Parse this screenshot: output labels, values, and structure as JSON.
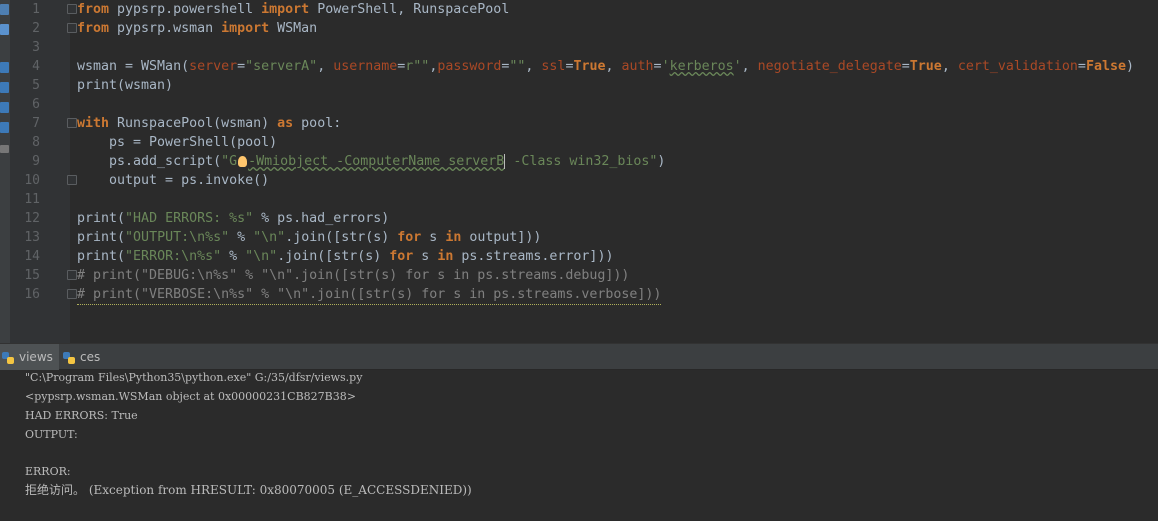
{
  "editor": {
    "line_numbers": [
      "1",
      "2",
      "3",
      "4",
      "5",
      "6",
      "7",
      "8",
      "9",
      "10",
      "11",
      "12",
      "13",
      "14",
      "15",
      "16"
    ],
    "code": {
      "l1": {
        "kw1": "from",
        "mod": " pypsrp.powershell ",
        "kw2": "import",
        "rest": " PowerShell, RunspacePool"
      },
      "l2": {
        "kw1": "from",
        "mod": " pypsrp.wsman ",
        "kw2": "import",
        "rest": " WSMan"
      },
      "l4": {
        "a": "wsman = WSMan(",
        "p1": "server",
        "eq1": "=",
        "s1": "\"serverA\"",
        "c1": ", ",
        "p2": "username",
        "eq2": "=",
        "s2": "r\"\"",
        "c2": ",",
        "p3": "password",
        "eq3": "=",
        "s3": "\"\"",
        "c3": ", ",
        "p4": "ssl",
        "eq4": "=",
        "k4": "True",
        "c4": ", ",
        "p5": "auth",
        "eq5": "=",
        "s5a": "'",
        "s5b": "kerberos",
        "s5c": "'",
        "c5": ", ",
        "p6": "negotiate_delegate",
        "eq6": "=",
        "k6": "True",
        "c6": ", ",
        "p7": "cert_validation",
        "eq7": "=",
        "k7": "False",
        "end": ")"
      },
      "l5": {
        "text": "print(wsman)"
      },
      "l7": {
        "kw1": "with",
        "mid": " RunspacePool(wsman) ",
        "kw2": "as",
        "rest": " pool:"
      },
      "l8": {
        "text": "    ps = PowerShell(pool)"
      },
      "l9": {
        "pre": "    ps.add_script(",
        "s1": "\"G",
        "s2": "-Wmiobject -ComputerName serverB",
        "s3": " -Class win32_bios\"",
        "end": ")"
      },
      "l10": {
        "text": "    output = ps.invoke()"
      },
      "l12": {
        "pre": "print(",
        "s": "\"HAD ERRORS: %s\"",
        "rest": " % ps.had_errors)"
      },
      "l13": {
        "pre": "print(",
        "s": "\"OUTPUT:\\n%s\"",
        "mid": " % ",
        "s2": "\"\\n\"",
        "rest1": ".join([str(s) ",
        "kw1": "for",
        "rest2": " s ",
        "kw2": "in",
        "rest3": " output]))"
      },
      "l14": {
        "pre": "print(",
        "s": "\"ERROR:\\n%s\"",
        "mid": " % ",
        "s2": "\"\\n\"",
        "rest1": ".join([str(s) ",
        "kw1": "for",
        "rest2": " s ",
        "kw2": "in",
        "rest3": " ps.streams.error]))"
      },
      "l15": {
        "text": "# print(\"DEBUG:\\n%s\" % \"\\n\".join([str(s) for s in ps.streams.debug]))"
      },
      "l16": {
        "text": "# print(\"VERBOSE:\\n%s\" % \"\\n\".join([str(s) for s in ps.streams.verbose]))"
      }
    }
  },
  "run_tabs": [
    {
      "label": "views"
    },
    {
      "label": "ces"
    }
  ],
  "console": {
    "lines": [
      "\"C:\\Program Files\\Python35\\python.exe\" G:/35/dfsr/views.py",
      "<pypsrp.wsman.WSMan object at 0x00000231CB827B38>",
      "HAD ERRORS: True",
      "OUTPUT:",
      "",
      "ERROR:",
      "拒绝访问。 (Exception from HRESULT: 0x80070005 (E_ACCESSDENIED))"
    ]
  },
  "colors": {
    "background": "#2b2b2b",
    "keyword": "#cc7832",
    "string": "#6a8759",
    "comment": "#808080",
    "param": "#aa4926"
  }
}
